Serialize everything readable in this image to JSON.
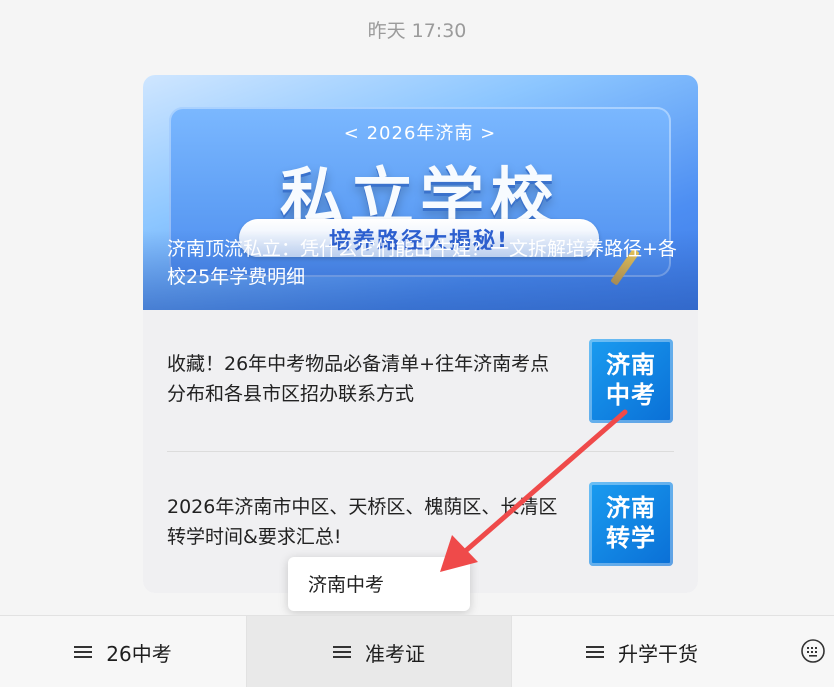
{
  "timestamp": "昨天 17:30",
  "article_card": {
    "cover": {
      "banner_tag": "< 2026年济南 >",
      "banner_title": "私立学校",
      "banner_subtitle": "培养路径大揭秘!",
      "title": "济南顶流私立：凭什么它们能出牛娃？一文拆解培养路径+各校25年学费明细"
    },
    "items": [
      {
        "title": "收藏！26年中考物品必备清单+往年济南考点分布和各县市区招办联系方式",
        "thumb_line1": "济南",
        "thumb_line2": "中考"
      },
      {
        "title": "2026年济南市中区、天桥区、槐荫区、长清区转学时间&要求汇总!",
        "thumb_line1": "济南",
        "thumb_line2": "转学"
      }
    ]
  },
  "tooltip": {
    "label": "济南中考"
  },
  "bottom_menu": {
    "items": [
      {
        "label": "26中考"
      },
      {
        "label": "准考证"
      },
      {
        "label": "升学干货"
      }
    ],
    "keyboard_icon": "keyboard-icon"
  },
  "colors": {
    "accent_blue": "#1a7ff0",
    "arrow_red": "#ef4a4a",
    "menu_active_bg": "#e9e9e9"
  }
}
